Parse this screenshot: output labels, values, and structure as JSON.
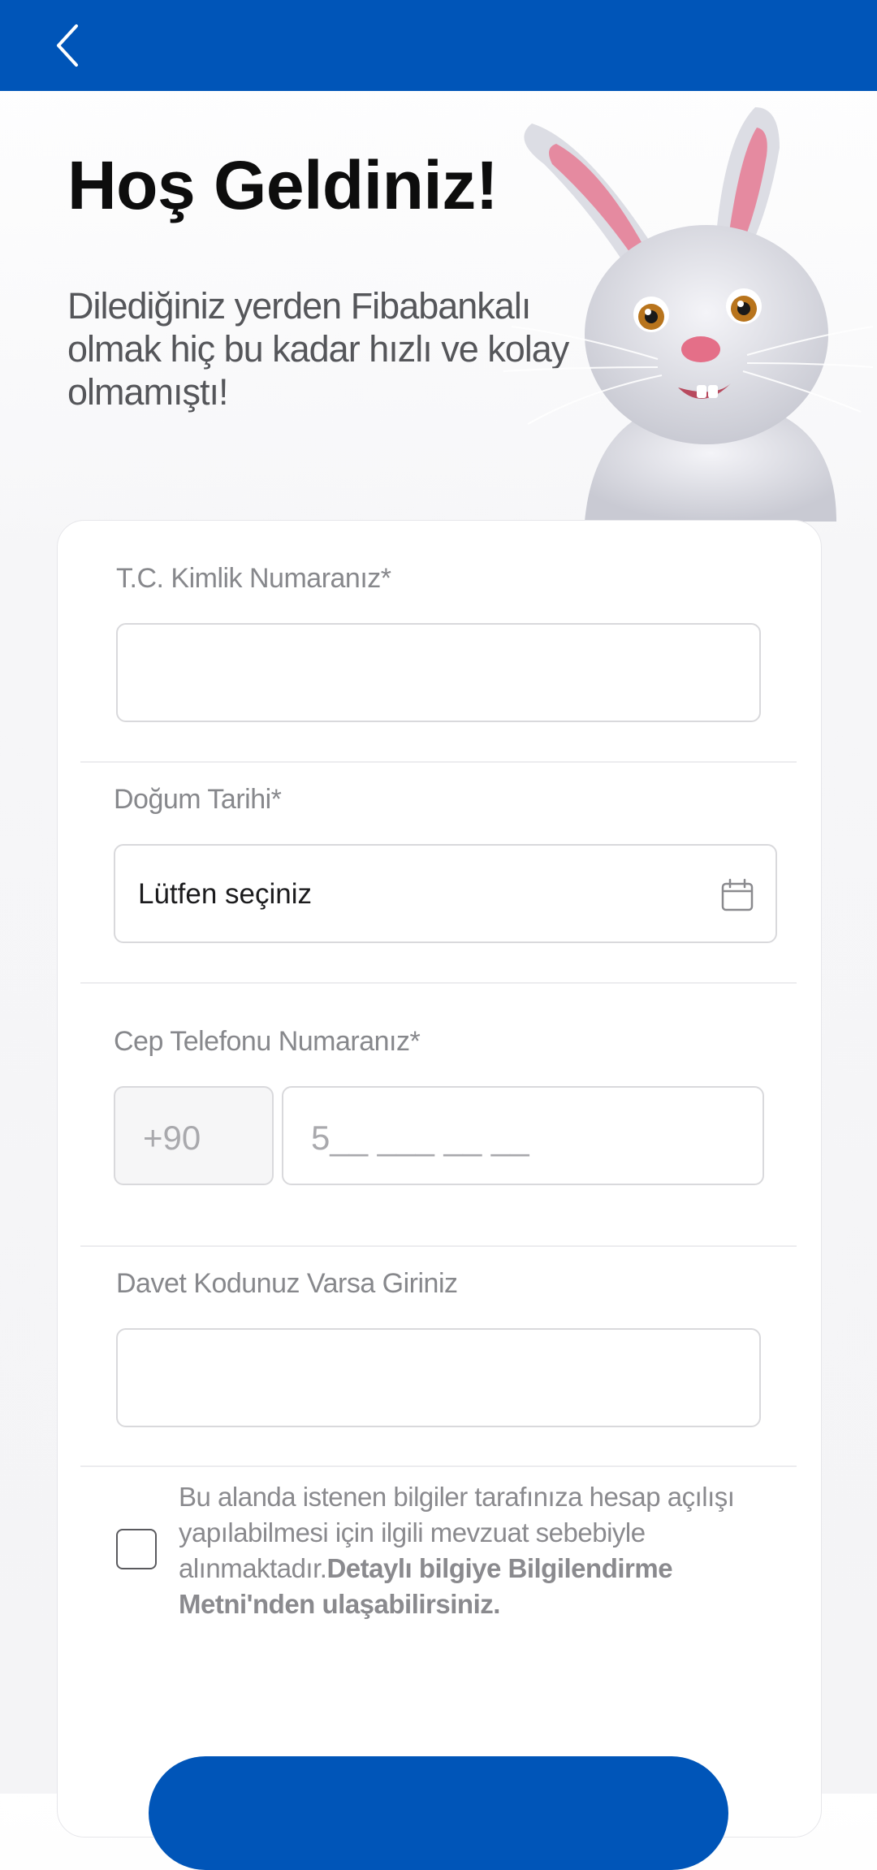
{
  "header": {
    "back_icon": "chevron-left-icon",
    "background": "#0055b8"
  },
  "welcome": {
    "title": "Hoş Geldiniz!",
    "subtitle": "Dilediğiniz yerden Fibabankalı olmak hiç bu kadar hızlı ve kolay olmamıştı!"
  },
  "form": {
    "tc_label": "T.C. Kimlik Numaranız*",
    "tc_value": "",
    "birth_label": "Doğum Tarihi*",
    "birth_value": "Lütfen seçiniz",
    "birth_icon": "calendar-icon",
    "phone_label": "Cep Telefonu Numaranız*",
    "phone_prefix": "+90",
    "phone_placeholder": "5__ ___ __ __",
    "invite_label": "Davet Kodunuz Varsa Giriniz",
    "invite_value": "",
    "consent_text": "Bu alanda istenen bilgiler tarafınıza hesap açılışı yapılabilmesi için ilgili mevzuat sebebiyle alınmaktadır.",
    "consent_link": "Detaylı bilgiye Bilgilendirme Metni'nden ulaşabilirsiniz.",
    "consent_checked": false
  },
  "colors": {
    "primary": "#0055b8",
    "label": "#87888c",
    "border": "#d9d9dc"
  }
}
